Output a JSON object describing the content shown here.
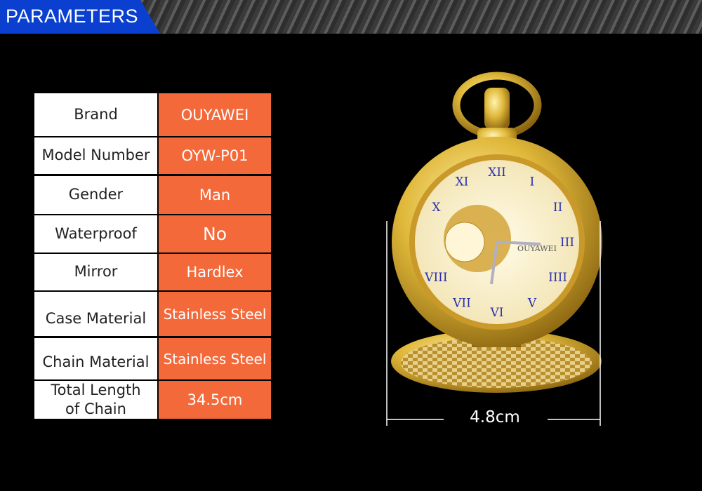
{
  "header": {
    "title": "PARAMETERS",
    "accent": "#0a3fd0"
  },
  "parameters": [
    {
      "label": "Brand",
      "value": "OUYAWEI"
    },
    {
      "label": "Model Number",
      "value": "OYW-P01"
    },
    {
      "label": "Gender",
      "value": "Man"
    },
    {
      "label": "Waterproof",
      "value": "No"
    },
    {
      "label": "Mirror",
      "value": "Hardlex"
    },
    {
      "label": "Case Material",
      "value": "Stainless Steel"
    },
    {
      "label": "Chain Material",
      "value": "Stainless Steel"
    },
    {
      "label": "Total Length of Chain",
      "value": "34.5cm"
    }
  ],
  "colors": {
    "value_cell": "#f3693a",
    "label_cell": "#ffffff"
  },
  "product": {
    "dial_brand": "OUYAWEI",
    "width_dimension": "4.8cm"
  }
}
